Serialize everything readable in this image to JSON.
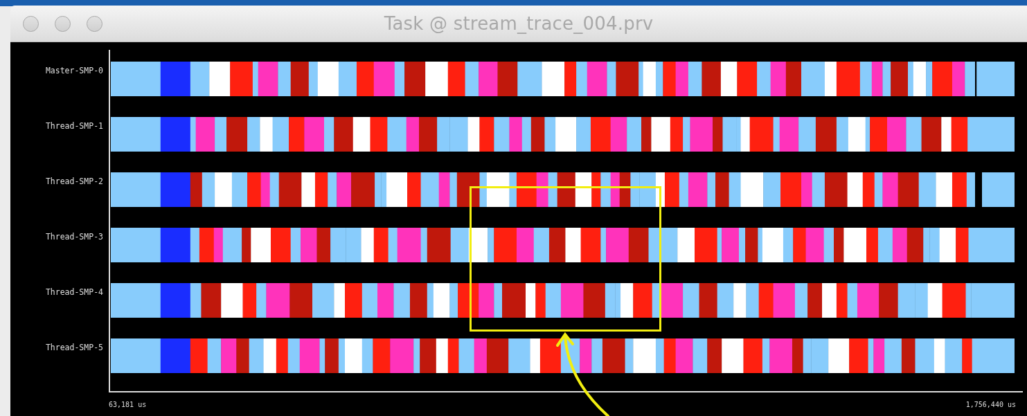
{
  "window": {
    "title": "Task @ stream_trace_004.prv"
  },
  "rows": [
    {
      "label": "Master-SMP-0"
    },
    {
      "label": "Thread-SMP-1"
    },
    {
      "label": "Thread-SMP-2"
    },
    {
      "label": "Thread-SMP-3"
    },
    {
      "label": "Thread-SMP-4"
    },
    {
      "label": "Thread-SMP-5"
    }
  ],
  "axis": {
    "start": "63,181 us",
    "end": "1,756,440 us"
  }
}
